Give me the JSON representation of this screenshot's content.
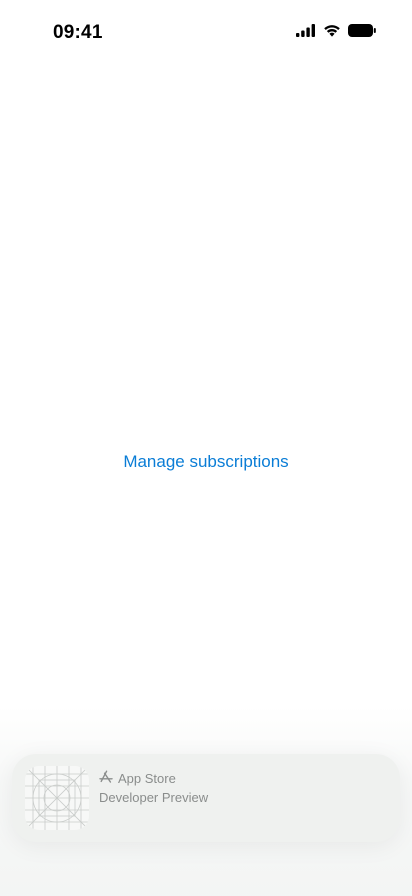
{
  "status_bar": {
    "time": "09:41",
    "icons": [
      "cellular-signal-icon",
      "wifi-icon",
      "battery-icon"
    ]
  },
  "main": {
    "manage_subscriptions_label": "Manage subscriptions"
  },
  "banner": {
    "store_label": "App Store",
    "subtitle": "Developer Preview",
    "store_icon": "app-store-icon",
    "app_icon": "app-icon-placeholder"
  },
  "colors": {
    "link": "#0a7dd6",
    "banner_background": "#eff1ef",
    "banner_text": "#8a8d8c"
  }
}
